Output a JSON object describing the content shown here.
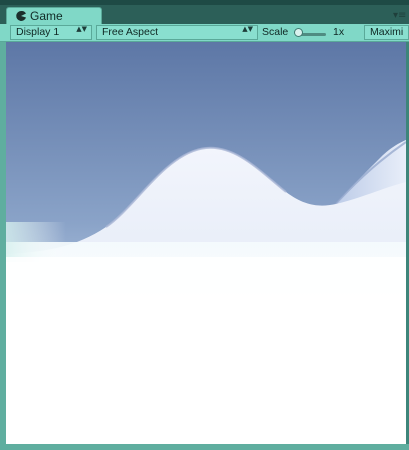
{
  "tab": {
    "label": "Game",
    "icon": "pacman-game-icon"
  },
  "tab_menu": {
    "icon": "panel-menu-icon",
    "glyph": "▾≡"
  },
  "toolbar": {
    "display_dropdown": {
      "value": "Display 1",
      "arrows": "▲▼"
    },
    "aspect_dropdown": {
      "value": "Free Aspect",
      "arrows": "▲▼"
    },
    "scale": {
      "label": "Scale",
      "value": "1x",
      "slider_position": 0
    },
    "maximize_button": {
      "label": "Maximi"
    }
  },
  "colors": {
    "tab_bar": "#2c5f58",
    "toolbar": "#80d8c7",
    "sky_top": "#5f79a8",
    "sky_horizon": "#c8d8ee",
    "snow": "#ffffff"
  }
}
